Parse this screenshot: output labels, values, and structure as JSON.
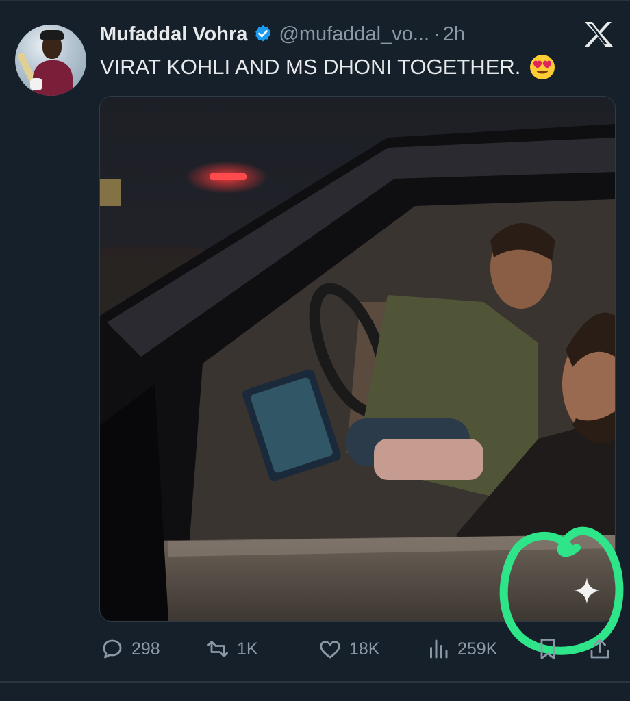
{
  "tweet": {
    "display_name": "Mufaddal Vohra",
    "handle": "@mufaddal_vo...",
    "separator": "·",
    "time": "2h",
    "text": "VIRAT KOHLI AND MS DHONI TOGETHER.",
    "emoji": "smiling-face-with-heart-eyes"
  },
  "actions": {
    "replies": "298",
    "retweets": "1K",
    "likes": "18K",
    "views": "259K"
  },
  "colors": {
    "background": "#15202b",
    "verified": "#1d9bf0",
    "muted": "#8b98a5",
    "annotation": "#2ee58a"
  },
  "icons": [
    "verified-badge-icon",
    "x-logo-icon",
    "reply-icon",
    "retweet-icon",
    "like-icon",
    "views-icon",
    "bookmark-icon",
    "share-icon",
    "sparkle-icon"
  ]
}
